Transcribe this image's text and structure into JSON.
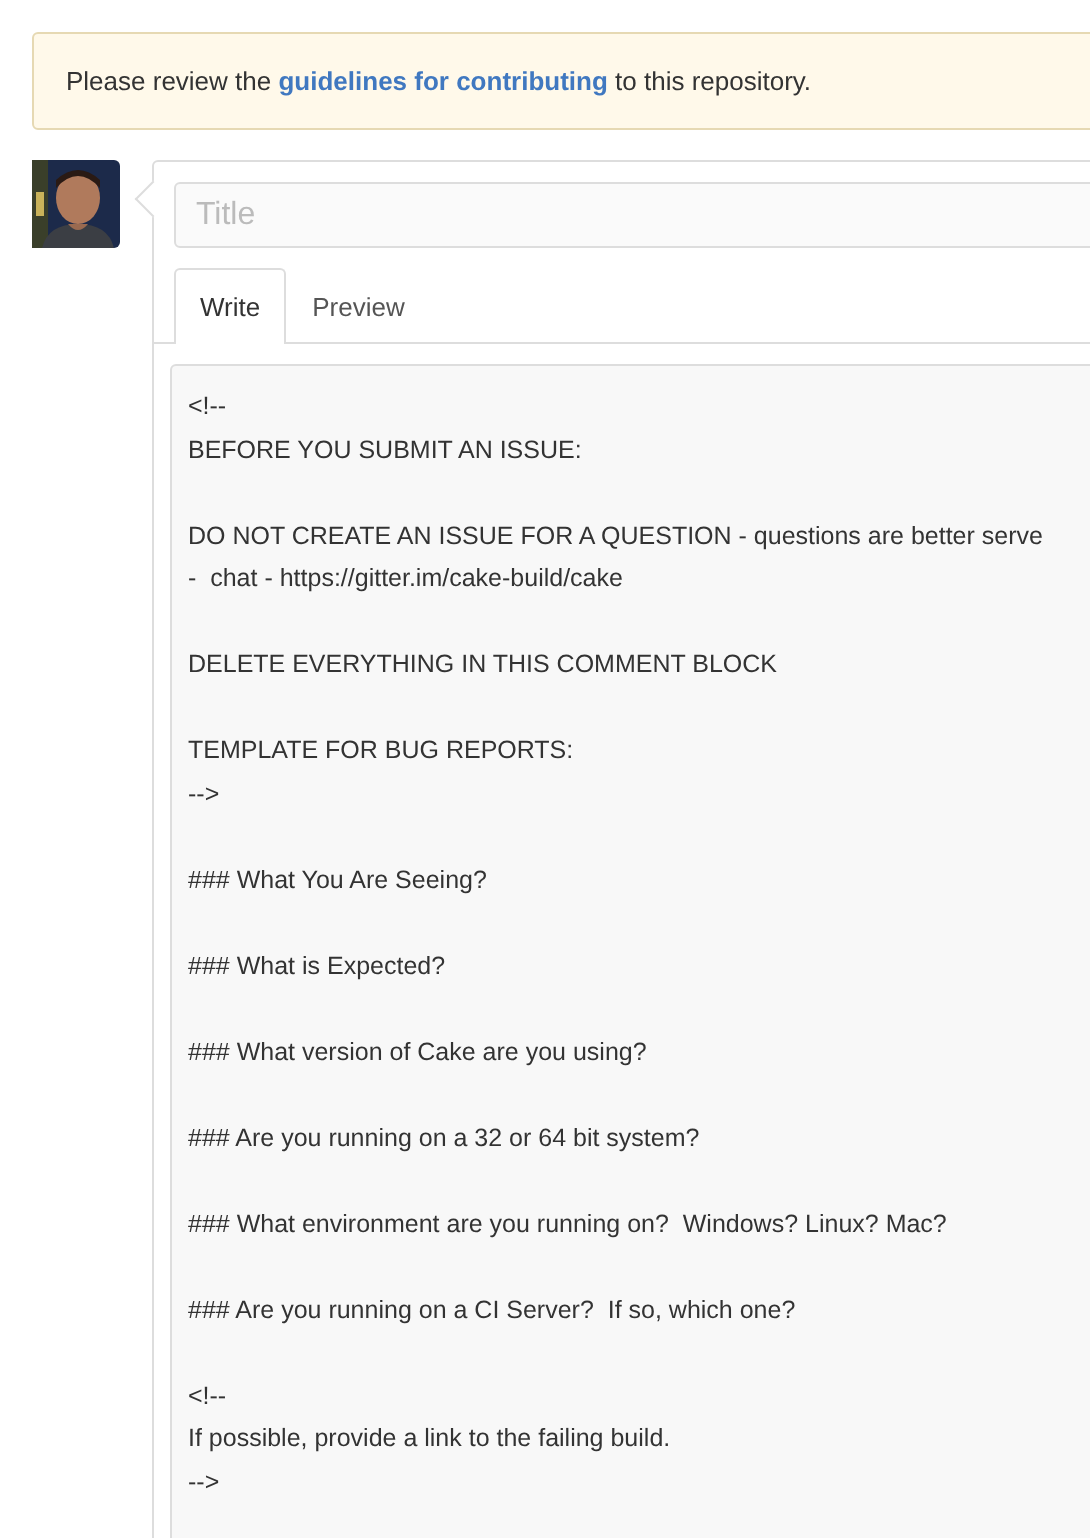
{
  "notice": {
    "before": "Please review the",
    "link": "guidelines for contributing",
    "after": "to this repository."
  },
  "title_field": {
    "placeholder": "Title"
  },
  "tabs": [
    {
      "label": "Write",
      "selected": true
    },
    {
      "label": "Preview",
      "selected": false
    }
  ],
  "body_field": {
    "value": "<!--\nBEFORE YOU SUBMIT AN ISSUE:\n\nDO NOT CREATE AN ISSUE FOR A QUESTION - questions are better serve\n-  chat - https://gitter.im/cake-build/cake\n\nDELETE EVERYTHING IN THIS COMMENT BLOCK\n\nTEMPLATE FOR BUG REPORTS:\n-->\n\n### What You Are Seeing?\n\n### What is Expected?\n\n### What version of Cake are you using?\n\n### Are you running on a 32 or 64 bit system?\n\n### What environment are you running on?  Windows? Linux? Mac?\n\n### Are you running on a CI Server?  If so, which one?\n\n<!--\nIf possible, provide a link to the failing build.\n-->"
  }
}
